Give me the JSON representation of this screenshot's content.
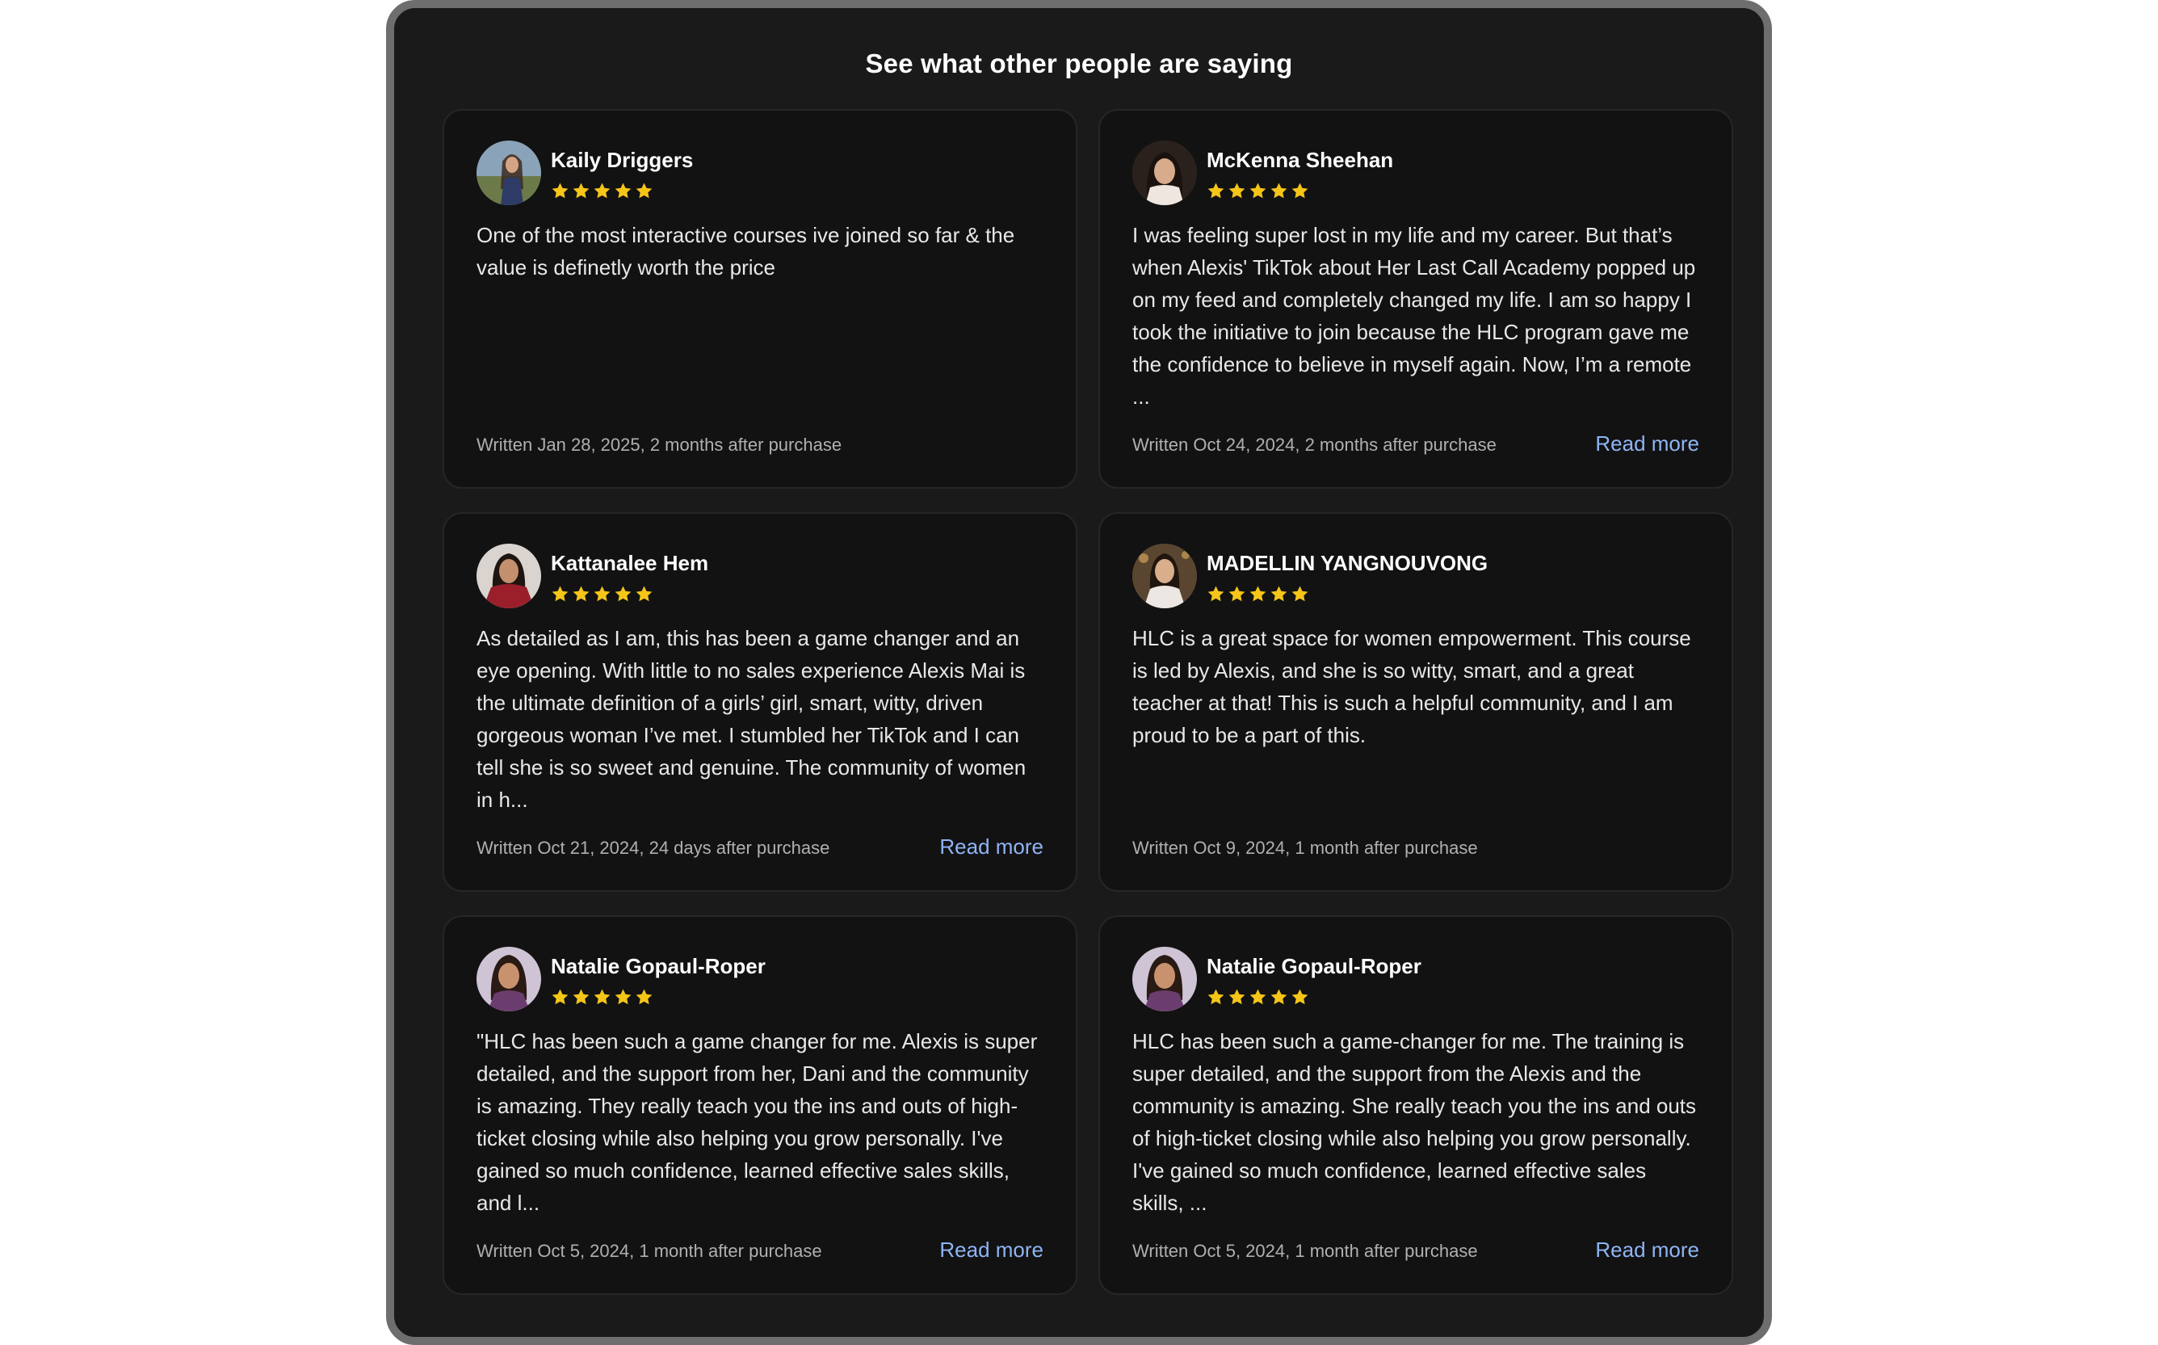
{
  "heading": "See what other people are saying",
  "colors": {
    "background": "#1a1a1a",
    "card": "#121212",
    "star": "#f5c518",
    "link": "#8fb4f5"
  },
  "reviews": [
    {
      "name": "Kaily Driggers",
      "rating": 5,
      "text": "One of the most interactive courses ive joined so far & the value is definetly worth the price",
      "written": "Written Jan 28, 2025, 2 months after purchase",
      "read_more": ""
    },
    {
      "name": "McKenna Sheehan",
      "rating": 5,
      "text": "I was feeling super lost in my life and my career. But that’s when Alexis' TikTok about Her Last Call Academy popped up on my feed and completely changed my life. I am so happy I took the initiative to join because the HLC program gave me the confidence to believe in myself again. Now, I’m a remote ...",
      "written": "Written Oct 24, 2024, 2 months after purchase",
      "read_more": "Read more"
    },
    {
      "name": "Kattanalee Hem",
      "rating": 5,
      "text": "As detailed as I am, this has been a game changer and an eye opening. With little to no sales experience Alexis Mai is the ultimate definition of a girls’ girl, smart, witty, driven gorgeous woman I’ve met. I stumbled her TikTok and I can tell she is so sweet and genuine. The community of women in h...",
      "written": "Written Oct 21, 2024, 24 days after purchase",
      "read_more": "Read more"
    },
    {
      "name": "MADELLIN YANGNOUVONG",
      "rating": 5,
      "text": "HLC is a great space for women empowerment. This course is led by Alexis, and she is so witty, smart, and a great teacher at that! This is such a helpful community, and I am proud to be a part of this.",
      "written": "Written Oct 9, 2024, 1 month after purchase",
      "read_more": ""
    },
    {
      "name": "Natalie Gopaul-Roper",
      "rating": 5,
      "text": "\"HLC has been such a game changer for me. Alexis is super detailed, and the support from her, Dani and the community is amazing. They really teach you the ins and outs of high-ticket closing while also helping you grow personally. I've gained so much confidence, learned effective sales skills, and l...",
      "written": "Written Oct 5, 2024, 1 month after purchase",
      "read_more": "Read more"
    },
    {
      "name": "Natalie Gopaul-Roper",
      "rating": 5,
      "text": "HLC has been such a game-changer for me. The training is super detailed, and the support from the Alexis and the community is amazing. She really teach you the ins and outs of high-ticket closing while also helping you grow personally. I've gained so much confidence, learned effective sales skills, ...",
      "written": "Written Oct 5, 2024, 1 month after purchase",
      "read_more": "Read more"
    }
  ]
}
